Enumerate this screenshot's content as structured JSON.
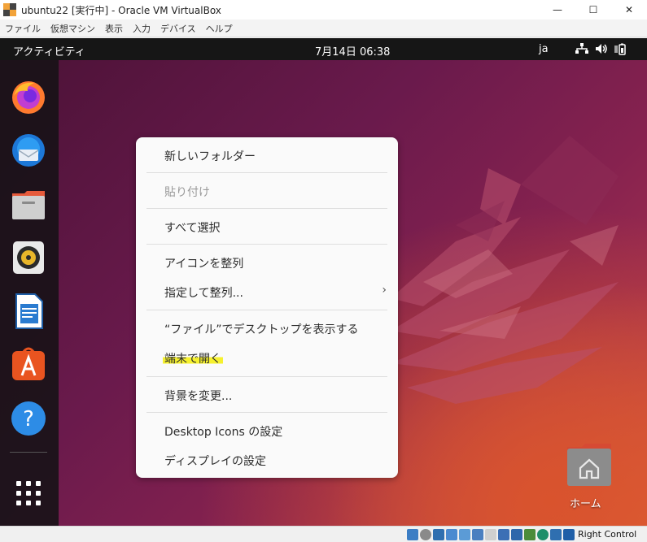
{
  "window": {
    "title": "ubuntu22 [実行中] - Oracle VM VirtualBox",
    "minimize": "—",
    "maximize": "☐",
    "close": "✕"
  },
  "menubar": {
    "items": [
      "ファイル",
      "仮想マシン",
      "表示",
      "入力",
      "デバイス",
      "ヘルプ"
    ]
  },
  "topbar": {
    "activities": "アクティビティ",
    "clock": "7月14日  06:38",
    "language": "ja",
    "tray_icons": [
      "network-icon",
      "volume-icon",
      "battery-icon"
    ]
  },
  "dock": {
    "apps": [
      "firefox-icon",
      "thunderbird-icon",
      "files-icon",
      "rhythmbox-icon",
      "libreoffice-writer-icon",
      "app-center-icon",
      "help-icon"
    ],
    "show_apps": "show-applications-icon"
  },
  "context_menu": {
    "new_folder": "新しいフォルダー",
    "paste": "貼り付け",
    "select_all": "すべて選択",
    "arrange_icons": "アイコンを整列",
    "arrange_by": "指定して整列...",
    "arrange_by_arrow": "›",
    "show_in_files": "“ファイル”でデスクトップを表示する",
    "open_terminal": "端末で開く",
    "change_background": "背景を変更...",
    "desktop_icons_settings": "Desktop Icons の設定",
    "display_settings": "ディスプレイの設定"
  },
  "desktop": {
    "home_label": "ホーム"
  },
  "statusbar": {
    "host_key": "Right Control"
  },
  "colors": {
    "highlight": "#f6f12e",
    "topbar": "#161616",
    "menu_bg": "#fafafa",
    "accent_orange": "#e95420"
  }
}
